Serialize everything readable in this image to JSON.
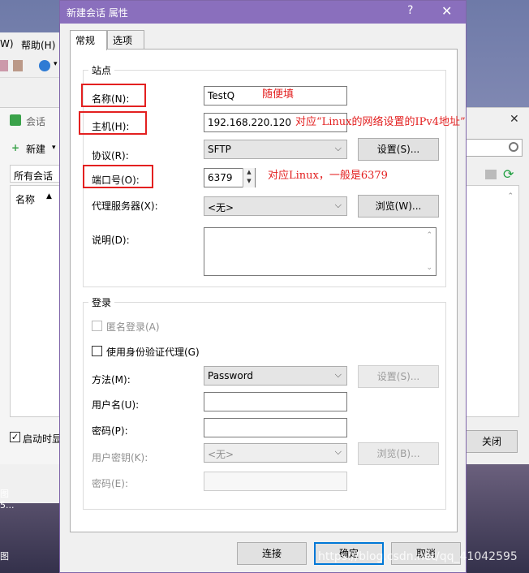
{
  "background_app": {
    "menu_w": "W)",
    "menu_help": "帮助(H)",
    "session_tab": "会话",
    "new_button": "新建",
    "all_sessions": "所有会话",
    "name_col": "名称",
    "startup_check": "启动时显",
    "close_button": "关闭",
    "tip_a": "图",
    "tip_b": "5...",
    "tip_c": "图",
    "watermark": "https://blog.csdn.net/qq_41042595"
  },
  "dialog": {
    "title": "新建会话 属性",
    "help_glyph": "?",
    "close_glyph": "✕",
    "tabs": [
      "常规",
      "选项"
    ],
    "site": {
      "group_title": "站点",
      "name_label": "名称(N):",
      "name_value": "TestQ",
      "host_label": "主机(H):",
      "host_value": "192.168.220.120",
      "protocol_label": "协议(R):",
      "protocol_value": "SFTP",
      "settings_button": "设置(S)...",
      "port_label": "端口号(O):",
      "port_value": "6379",
      "proxy_label": "代理服务器(X):",
      "proxy_value": "<无>",
      "browse_button": "浏览(W)...",
      "desc_label": "说明(D):"
    },
    "login": {
      "group_title": "登录",
      "anonymous_label": "匿名登录(A)",
      "agent_label": "使用身份验证代理(G)",
      "method_label": "方法(M):",
      "method_value": "Password",
      "method_settings_button": "设置(S)...",
      "username_label": "用户名(U):",
      "username_value": "",
      "password_label": "密码(P):",
      "password_value": "",
      "userkey_label": "用户密钥(K):",
      "userkey_value": "<无>",
      "userkey_browse_button": "浏览(B)...",
      "passphrase_label": "密码(E):",
      "passphrase_value": ""
    },
    "footer": {
      "connect_button": "连接",
      "ok_button": "确定",
      "cancel_button": "取消"
    }
  },
  "annotations": {
    "name_note": "随便填",
    "host_note": "对应“Linux的网络设置的IPv4地址”",
    "port_note": "对应Linux，一般是6379",
    "color": "#e32020"
  }
}
